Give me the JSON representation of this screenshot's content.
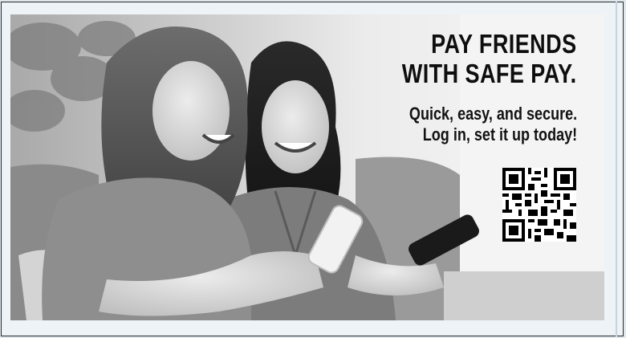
{
  "ad": {
    "headline_line1": "PAY FRIENDS",
    "headline_line2": "WITH SAFE PAY.",
    "sub_line1": "Quick, easy, and secure.",
    "sub_line2": "Log in, set it up today!"
  },
  "icons": {
    "qr": "qr-code-icon"
  },
  "colors": {
    "text": "#0e0e0e",
    "page_background": "#dfe8ef",
    "border": "#2b2b2b"
  }
}
